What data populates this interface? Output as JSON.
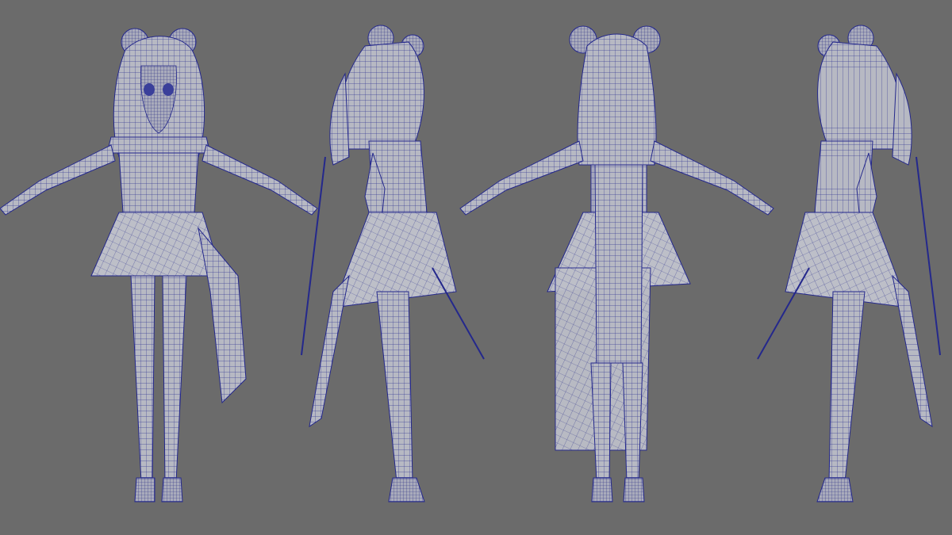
{
  "viewport": {
    "background": "#6b6b6b",
    "mesh_fill": "#b7b9c3",
    "wire_color": "#24288c"
  },
  "views": [
    {
      "view": "front"
    },
    {
      "view": "side-right"
    },
    {
      "view": "back"
    },
    {
      "view": "side-left"
    }
  ]
}
